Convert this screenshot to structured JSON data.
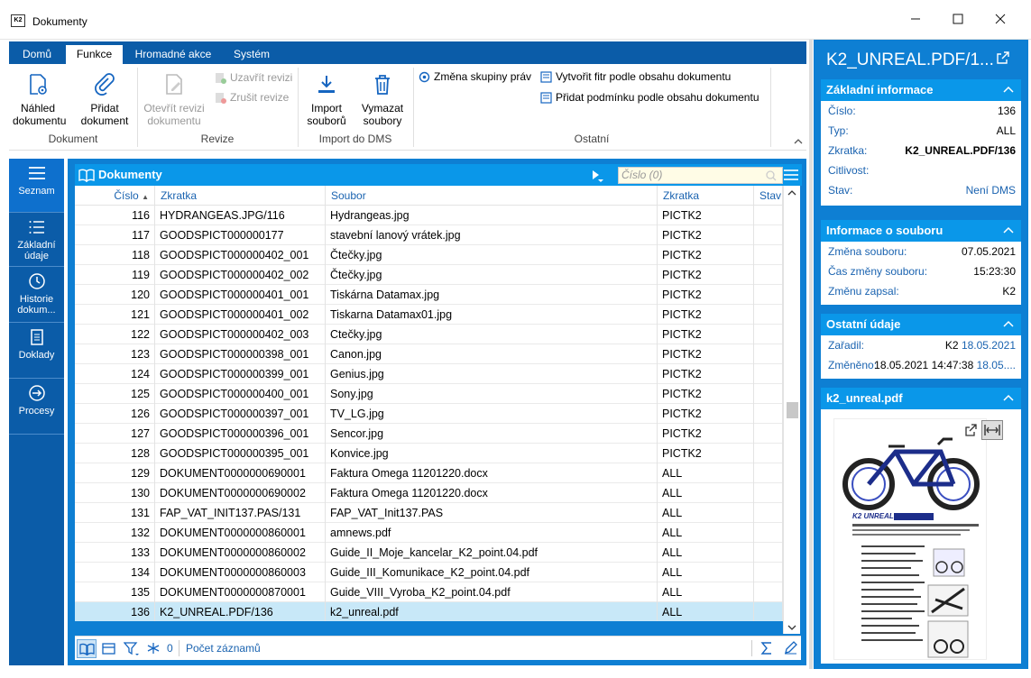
{
  "window": {
    "title": "Dokumenty",
    "app_icon": "K2"
  },
  "ribbon": {
    "tabs": [
      {
        "label": "Domů"
      },
      {
        "label": "Funkce"
      },
      {
        "label": "Hromadné akce"
      },
      {
        "label": "Systém"
      }
    ],
    "buttons": {
      "nahled": "Náhled dokumentu",
      "pridat": "Přidat dokument",
      "otevrit_revizi": "Otevřít revizi dokumentu",
      "uzavrit_revizi": "Uzavřít revizi",
      "zrusit_revizi": "Zrušit revize",
      "import": "Import souborů",
      "vymazat": "Vymazat soubory",
      "zmena_prav": "Změna skupiny práv",
      "vytvorit_filtr": "Vytvořit fitr podle obsahu dokumentu",
      "pridat_podminku": "Přidat podmínku podle obsahu dokumentu"
    },
    "groups": {
      "dokument": "Dokument",
      "revize": "Revize",
      "import": "Import do DMS",
      "ostatni": "Ostatní"
    }
  },
  "leftnav": [
    {
      "label": "Seznam",
      "icon": "hamburger-icon"
    },
    {
      "label": "Základní údaje",
      "icon": "list-icon"
    },
    {
      "label": "Historie dokum...",
      "icon": "clock-icon"
    },
    {
      "label": "Doklady",
      "icon": "document-icon"
    },
    {
      "label": "Procesy",
      "icon": "process-icon"
    }
  ],
  "grid": {
    "title": "Dokumenty",
    "search_placeholder": "Číslo (0)",
    "columns": [
      "Číslo",
      "Zkratka",
      "Soubor",
      "Zkratka",
      "Stav"
    ],
    "rows": [
      [
        "116",
        "HYDRANGEAS.JPG/116",
        "Hydrangeas.jpg",
        "PICTK2",
        ""
      ],
      [
        "117",
        "GOODSPICT000000177",
        "stavební lanový vrátek.jpg",
        "PICTK2",
        ""
      ],
      [
        "118",
        "GOODSPICT000000402_001",
        "Čtečky.jpg",
        "PICTK2",
        ""
      ],
      [
        "119",
        "GOODSPICT000000402_002",
        "Čtečky.jpg",
        "PICTK2",
        ""
      ],
      [
        "120",
        "GOODSPICT000000401_001",
        "Tiskárna Datamax.jpg",
        "PICTK2",
        ""
      ],
      [
        "121",
        "GOODSPICT000000401_002",
        "Tiskarna Datamax01.jpg",
        "PICTK2",
        ""
      ],
      [
        "122",
        "GOODSPICT000000402_003",
        "Ctečky.jpg",
        "PICTK2",
        ""
      ],
      [
        "123",
        "GOODSPICT000000398_001",
        "Canon.jpg",
        "PICTK2",
        ""
      ],
      [
        "124",
        "GOODSPICT000000399_001",
        "Genius.jpg",
        "PICTK2",
        ""
      ],
      [
        "125",
        "GOODSPICT000000400_001",
        "Sony.jpg",
        "PICTK2",
        ""
      ],
      [
        "126",
        "GOODSPICT000000397_001",
        "TV_LG.jpg",
        "PICTK2",
        ""
      ],
      [
        "127",
        "GOODSPICT000000396_001",
        "Sencor.jpg",
        "PICTK2",
        ""
      ],
      [
        "128",
        "GOODSPICT000000395_001",
        "Konvice.jpg",
        "PICTK2",
        ""
      ],
      [
        "129",
        "DOKUMENT0000000690001",
        "Faktura Omega 11201220.docx",
        "ALL",
        ""
      ],
      [
        "130",
        "DOKUMENT0000000690002",
        "Faktura Omega 11201220.docx",
        "ALL",
        ""
      ],
      [
        "131",
        "FAP_VAT_INIT137.PAS/131",
        "FAP_VAT_Init137.PAS",
        "ALL",
        ""
      ],
      [
        "132",
        "DOKUMENT0000000860001",
        "amnews.pdf",
        "ALL",
        ""
      ],
      [
        "133",
        "DOKUMENT0000000860002",
        "Guide_II_Moje_kancelar_K2_point.04.pdf",
        "ALL",
        ""
      ],
      [
        "134",
        "DOKUMENT0000000860003",
        "Guide_III_Komunikace_K2_point.04.pdf",
        "ALL",
        ""
      ],
      [
        "135",
        "DOKUMENT0000000870001",
        "Guide_VIII_Vyroba_K2_point.04.pdf",
        "ALL",
        ""
      ],
      [
        "136",
        "K2_UNREAL.PDF/136",
        "k2_unreal.pdf",
        "ALL",
        ""
      ]
    ],
    "selected_row": "136",
    "footer": {
      "filter_count": "0",
      "pocet": "Počet záznamů"
    }
  },
  "right_panel": {
    "title": "K2_UNREAL.PDF/1...",
    "zakladni": {
      "heading": "Základní informace",
      "rows": [
        {
          "label": "Číslo:",
          "value": "136"
        },
        {
          "label": "Typ:",
          "value": "ALL"
        },
        {
          "label": "Zkratka:",
          "value": "K2_UNREAL.PDF/136"
        },
        {
          "label": "Citlivost:",
          "value": ""
        },
        {
          "label": "Stav:",
          "value": "Není DMS"
        }
      ]
    },
    "soubor": {
      "heading": "Informace o souboru",
      "rows": [
        {
          "label": "Změna souboru:",
          "value": "07.05.2021"
        },
        {
          "label": "Čas změny souboru:",
          "value": "15:23:30"
        },
        {
          "label": "Změnu zapsal:",
          "value": "K2"
        }
      ]
    },
    "ostatni": {
      "heading": "Ostatní údaje",
      "zaradil_label": "Zařadil:",
      "zaradil_user": "K2",
      "zaradil_date": "18.05.2021",
      "zmeneno_label": "Změněno:",
      "zmeneno_val": "18.05.2021 14:47:38",
      "zmeneno_link": "18.05...."
    },
    "preview": {
      "heading": "k2_unreal.pdf",
      "logo_text": "K2 UNREAL"
    }
  },
  "colors": {
    "brand": "#0b5ca8",
    "panel": "#0e7fd3",
    "header": "#0a97e9",
    "link": "#1a63b0",
    "selected": "#c8e8f8"
  }
}
